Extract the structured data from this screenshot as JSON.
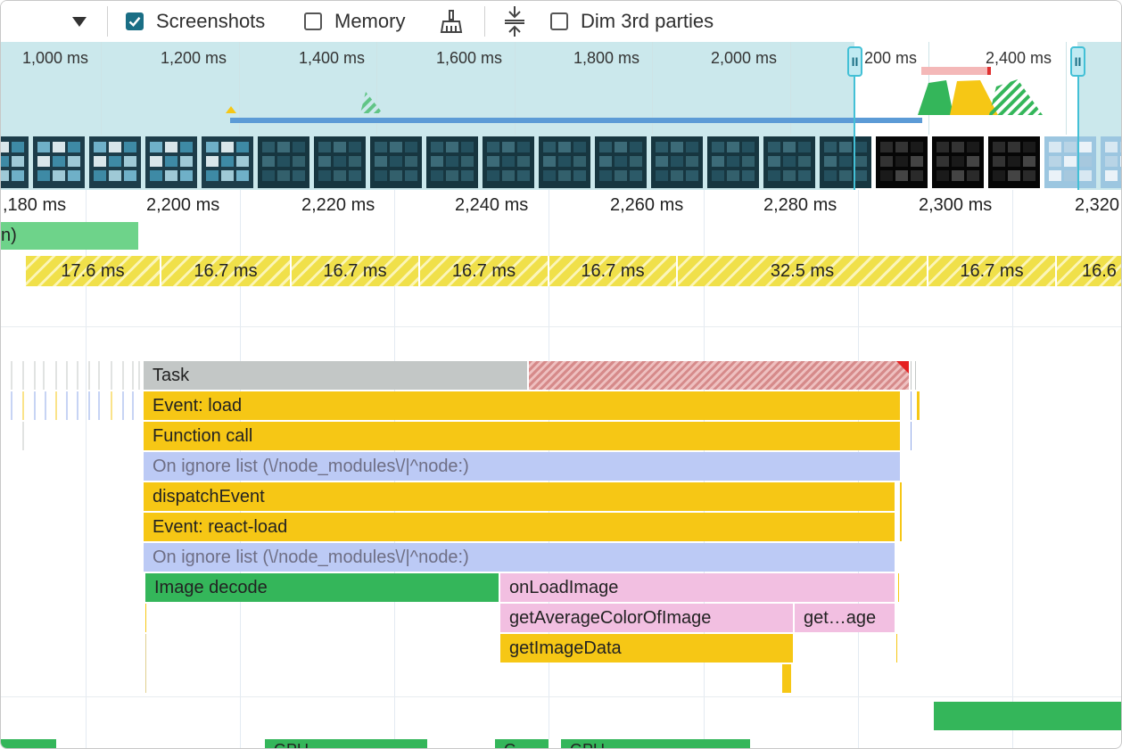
{
  "toolbar": {
    "menu_icon": "dropdown-triangle",
    "screenshots_label": "Screenshots",
    "screenshots_checked": true,
    "memory_label": "Memory",
    "memory_checked": false,
    "gc_icon": "broom-icon",
    "collapse_icon": "collapse-vertical-icon",
    "dim_label": "Dim 3rd parties",
    "dim_checked": false
  },
  "overview": {
    "tick_labels": [
      "1,000 ms",
      "1,200 ms",
      "1,400 ms",
      "1,600 ms",
      "1,800 ms",
      "2,000 ms",
      "200 ms",
      "2,400 ms"
    ],
    "handle_glyph": "II"
  },
  "ruler": {
    "labels": [
      ",180 ms",
      "2,200 ms",
      "2,220 ms",
      "2,240 ms",
      "2,260 ms",
      "2,280 ms",
      "2,300 ms",
      "2,320"
    ]
  },
  "partial_label": "n)",
  "frames": [
    "17.6 ms",
    "16.7 ms",
    "16.7 ms",
    "16.7 ms",
    "16.7 ms",
    "32.5 ms",
    "16.7 ms",
    "16.6"
  ],
  "flame": {
    "task": "Task",
    "event_load": "Event: load",
    "function_call": "Function call",
    "ignore1": "On ignore list (\\/node_modules\\/|^node:)",
    "dispatch_event": "dispatchEvent",
    "event_react_load": "Event: react-load",
    "ignore2": "On ignore list (\\/node_modules\\/|^node:)",
    "image_decode": "Image decode",
    "on_load_image": "onLoadImage",
    "get_average_color": "getAverageColorOfImage",
    "get_age": "get…age",
    "get_image_data": "getImageData"
  },
  "gpu": {
    "labels": [
      "GPU",
      "G",
      "GPU"
    ]
  },
  "colors": {
    "accent": "#1a6e85",
    "task_grey": "#c3c7c6",
    "script_yellow": "#f6c715",
    "ignore_blue": "#bccaf5",
    "render_green": "#34b65a",
    "paint_pink": "#f2bfe1",
    "long_task_red": "#e03030"
  }
}
